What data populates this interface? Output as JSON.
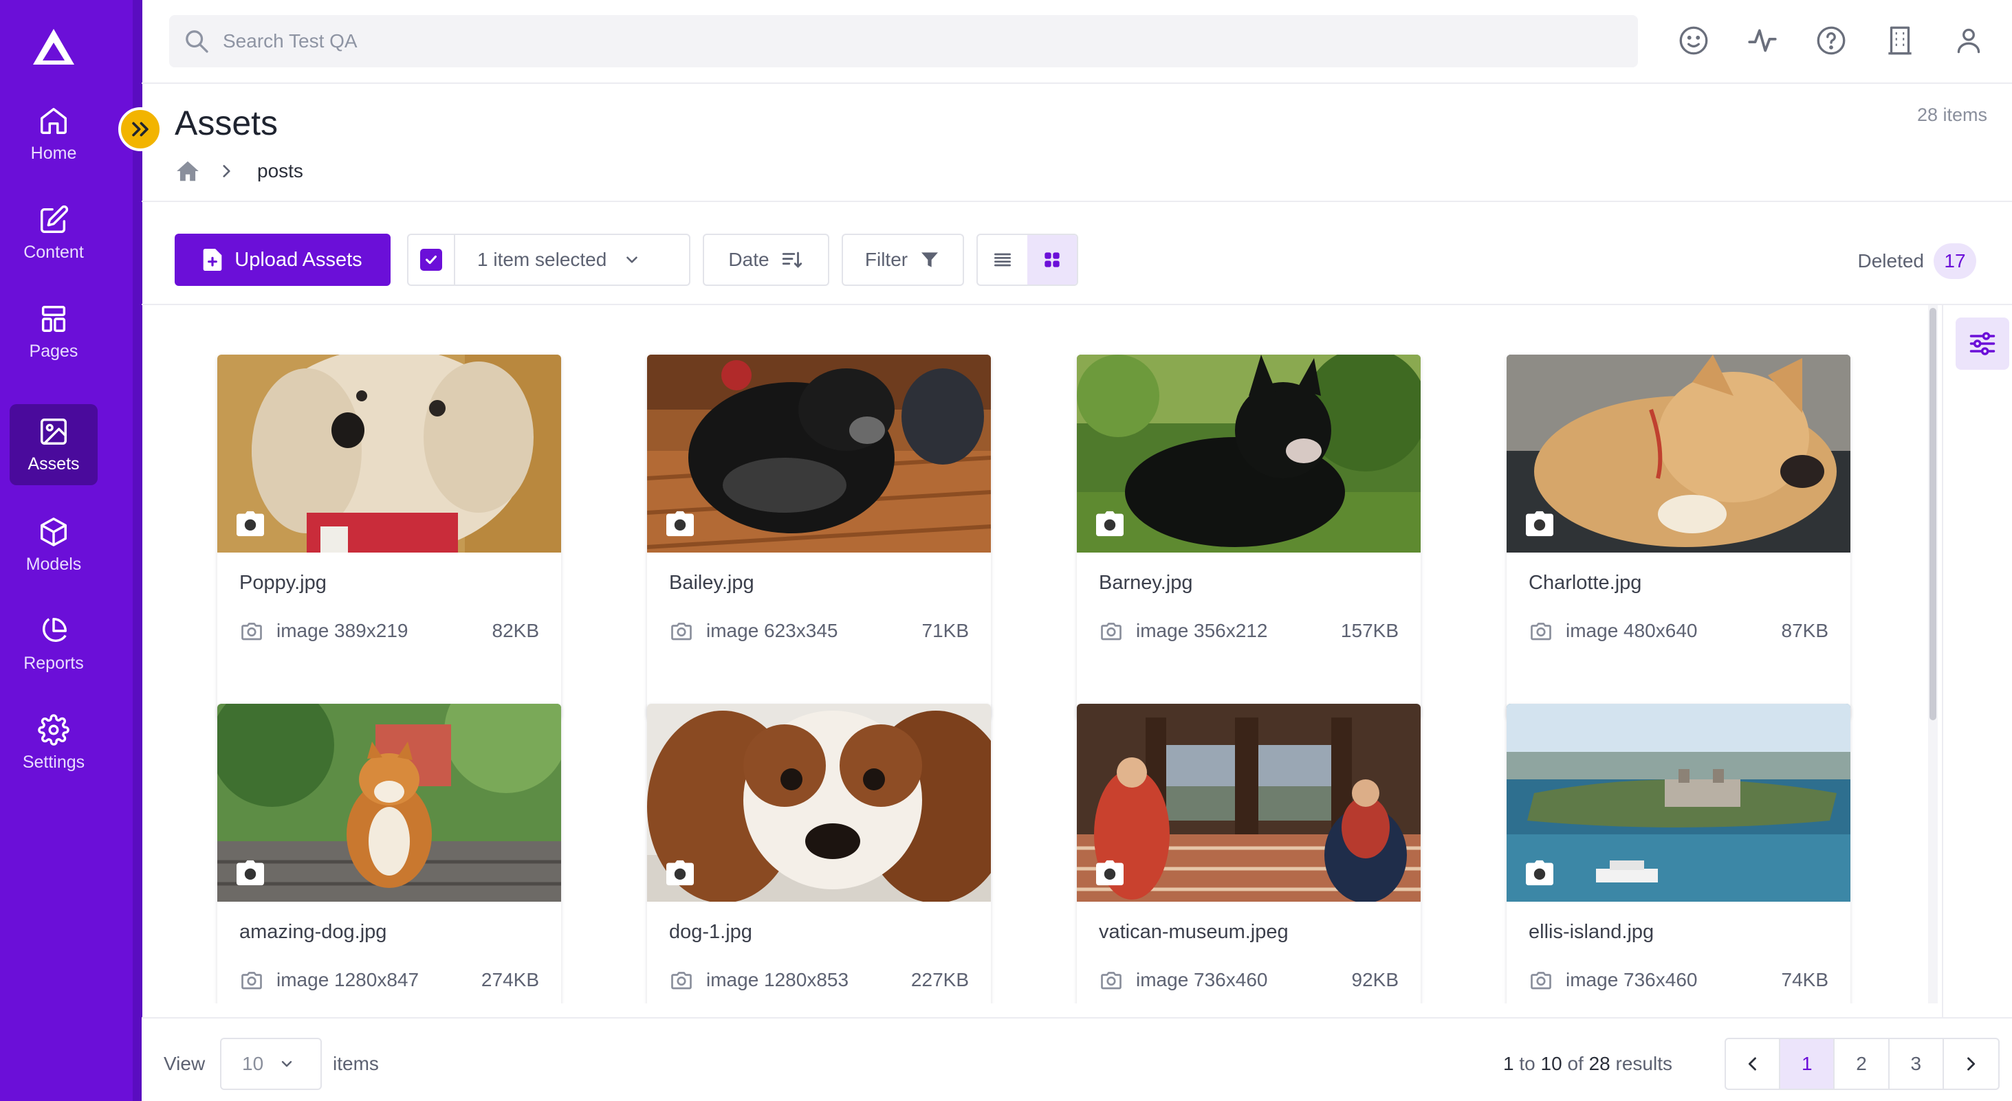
{
  "nav": {
    "items": [
      {
        "label": "Home",
        "icon": "home-icon"
      },
      {
        "label": "Content",
        "icon": "edit-icon"
      },
      {
        "label": "Pages",
        "icon": "layout-icon"
      },
      {
        "label": "Assets",
        "icon": "image-icon"
      },
      {
        "label": "Models",
        "icon": "cube-icon"
      },
      {
        "label": "Reports",
        "icon": "pie-chart-icon"
      },
      {
        "label": "Settings",
        "icon": "gear-icon"
      }
    ],
    "active": "Assets"
  },
  "search": {
    "placeholder": "Search Test QA"
  },
  "header_icons": [
    "smiley-icon",
    "activity-icon",
    "help-icon",
    "building-icon",
    "user-icon"
  ],
  "page": {
    "title": "Assets",
    "item_count": "28 items",
    "breadcrumb": [
      "posts"
    ]
  },
  "toolbar": {
    "upload_label": "Upload Assets",
    "selection_label": "1 item selected",
    "date_label": "Date",
    "filter_label": "Filter",
    "deleted_label": "Deleted",
    "deleted_count": "17",
    "view_mode": "grid"
  },
  "assets": [
    {
      "name": "Poppy.jpg",
      "type": "image 389x219",
      "size": "82KB"
    },
    {
      "name": "Bailey.jpg",
      "type": "image 623x345",
      "size": "71KB"
    },
    {
      "name": "Barney.jpg",
      "type": "image 356x212",
      "size": "157KB"
    },
    {
      "name": "Charlotte.jpg",
      "type": "image 480x640",
      "size": "87KB"
    },
    {
      "name": "amazing-dog.jpg",
      "type": "image 1280x847",
      "size": "274KB"
    },
    {
      "name": "dog-1.jpg",
      "type": "image 1280x853",
      "size": "227KB"
    },
    {
      "name": "vatican-museum.jpeg",
      "type": "image 736x460",
      "size": "92KB"
    },
    {
      "name": "ellis-island.jpg",
      "type": "image 736x460",
      "size": "74KB"
    }
  ],
  "footer": {
    "view_label": "View",
    "page_size": "10",
    "items_label": "items",
    "results_start": "1",
    "results_end": "10",
    "results_total": "28",
    "results_to": "to",
    "results_of": "of",
    "results_word": "results",
    "pages": [
      "1",
      "2",
      "3"
    ],
    "current_page": "1"
  },
  "colors": {
    "brand": "#6b0fd8",
    "brand_dark": "#4a0a9c",
    "accent_yellow": "#f2b400",
    "selected_bg": "#ece4fb"
  }
}
